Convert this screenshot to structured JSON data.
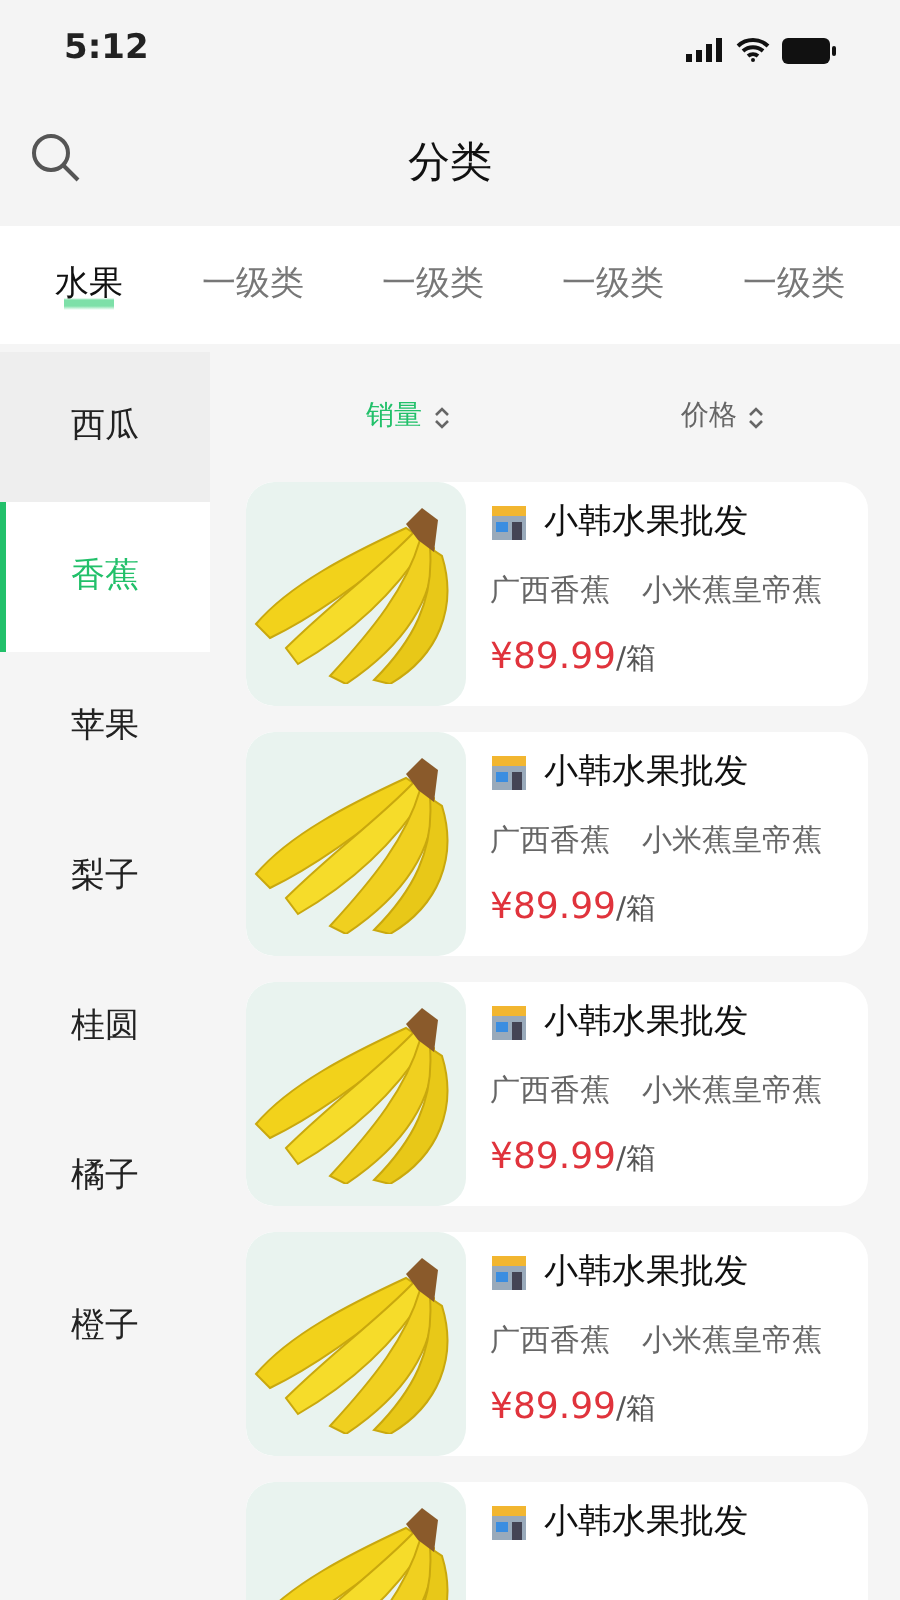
{
  "status_bar": {
    "time": "5:12"
  },
  "header": {
    "title": "分类"
  },
  "tabs": [
    {
      "label": "水果",
      "selected": true
    },
    {
      "label": "一级类",
      "selected": false
    },
    {
      "label": "一级类",
      "selected": false
    },
    {
      "label": "一级类",
      "selected": false
    },
    {
      "label": "一级类",
      "selected": false
    }
  ],
  "sidebar": {
    "items": [
      {
        "label": "西瓜",
        "selected": false
      },
      {
        "label": "香蕉",
        "selected": true
      },
      {
        "label": "苹果",
        "selected": false
      },
      {
        "label": "梨子",
        "selected": false
      },
      {
        "label": "桂圆",
        "selected": false
      },
      {
        "label": "橘子",
        "selected": false
      },
      {
        "label": "橙子",
        "selected": false
      }
    ]
  },
  "sort": [
    {
      "label": "销量",
      "selected": true
    },
    {
      "label": "价格",
      "selected": false
    }
  ],
  "products": [
    {
      "shop": "小韩水果批发",
      "tags": [
        "广西香蕉",
        "小米蕉皇帝蕉"
      ],
      "price": "¥89.99",
      "unit": "/箱"
    },
    {
      "shop": "小韩水果批发",
      "tags": [
        "广西香蕉",
        "小米蕉皇帝蕉"
      ],
      "price": "¥89.99",
      "unit": "/箱"
    },
    {
      "shop": "小韩水果批发",
      "tags": [
        "广西香蕉",
        "小米蕉皇帝蕉"
      ],
      "price": "¥89.99",
      "unit": "/箱"
    },
    {
      "shop": "小韩水果批发",
      "tags": [
        "广西香蕉",
        "小米蕉皇帝蕉"
      ],
      "price": "¥89.99",
      "unit": "/箱"
    },
    {
      "shop": "小韩水果批发"
    }
  ]
}
